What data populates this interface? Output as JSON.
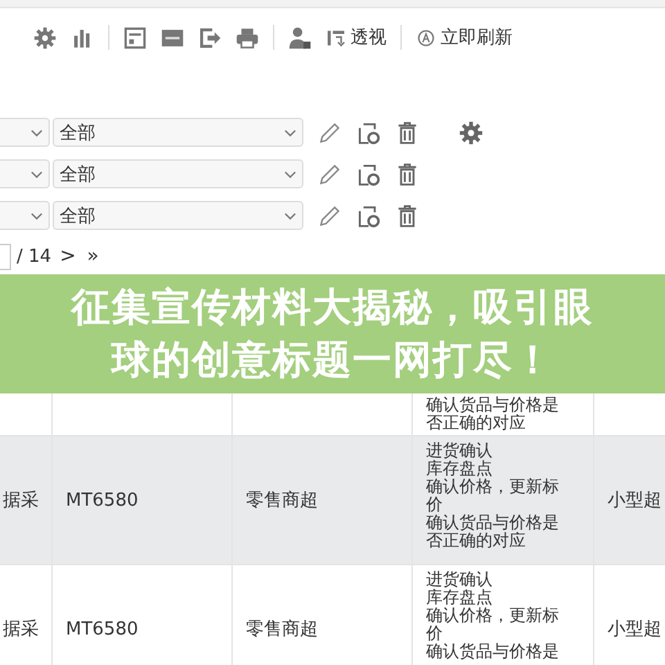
{
  "toolbar": {
    "tools": [
      {
        "kind": "gear"
      },
      {
        "kind": "chart"
      },
      {
        "kind": "divider"
      },
      {
        "kind": "form"
      },
      {
        "kind": "sql"
      },
      {
        "kind": "export"
      },
      {
        "kind": "print"
      },
      {
        "kind": "divider"
      },
      {
        "kind": "user"
      },
      {
        "kind": "pivot",
        "label": "透视"
      },
      {
        "kind": "divider"
      },
      {
        "kind": "refresh",
        "label": "立即刷新"
      }
    ]
  },
  "filters": [
    {
      "value": "全部",
      "settings": true
    },
    {
      "value": "全部",
      "settings": false
    },
    {
      "value": "全部",
      "settings": false
    }
  ],
  "pagination": {
    "total": "/ 14",
    "next": ">",
    "last": "»"
  },
  "table": {
    "rows": [
      {
        "selected": false,
        "lines": [
          "确认货品与价格是否正确的对应"
        ]
      },
      {
        "selected": true,
        "cells": [
          "据采",
          "MT6580",
          "零售商超",
          "小型超"
        ],
        "lines": [
          "进货确认",
          "库存盘点",
          "确认价格，更新标价",
          "确认货品与价格是否正确的对应"
        ]
      },
      {
        "selected": false,
        "cells": [
          "据采",
          "MT6580",
          "零售商超",
          "小型超"
        ],
        "lines": [
          "进货确认",
          "库存盘点",
          "确认价格，更新标价",
          "确认货品与价格是"
        ]
      }
    ]
  },
  "banner": {
    "title": "征集宣传材料大揭秘，吸引眼球的创意标题一网打尽！"
  }
}
